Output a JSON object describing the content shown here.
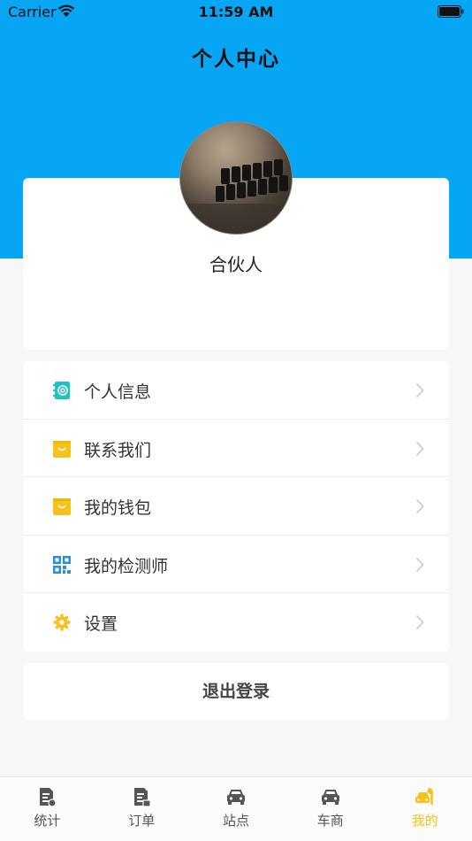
{
  "status_bar": {
    "carrier": "Carrier",
    "time": "11:59 AM"
  },
  "header": {
    "title": "个人中心"
  },
  "profile": {
    "name": "合伙人"
  },
  "menu": {
    "items": [
      {
        "label": "个人信息",
        "icon": "contact-book-icon"
      },
      {
        "label": "联系我们",
        "icon": "shopping-bag-icon"
      },
      {
        "label": "我的钱包",
        "icon": "shopping-bag-icon"
      },
      {
        "label": "我的检测师",
        "icon": "qr-code-icon"
      },
      {
        "label": "设置",
        "icon": "gear-icon"
      }
    ]
  },
  "logout": {
    "label": "退出登录"
  },
  "tabbar": {
    "tabs": [
      {
        "label": "统计",
        "icon": "report-icon"
      },
      {
        "label": "订单",
        "icon": "order-icon"
      },
      {
        "label": "站点",
        "icon": "car-icon"
      },
      {
        "label": "车商",
        "icon": "car-icon"
      },
      {
        "label": "我的",
        "icon": "car-repair-icon",
        "active": true
      }
    ]
  },
  "colors": {
    "header_blue": "#06a6f5",
    "accent_yellow": "#f7c21c",
    "icon_teal": "#22c2c0",
    "icon_blue": "#2d8fd6"
  }
}
